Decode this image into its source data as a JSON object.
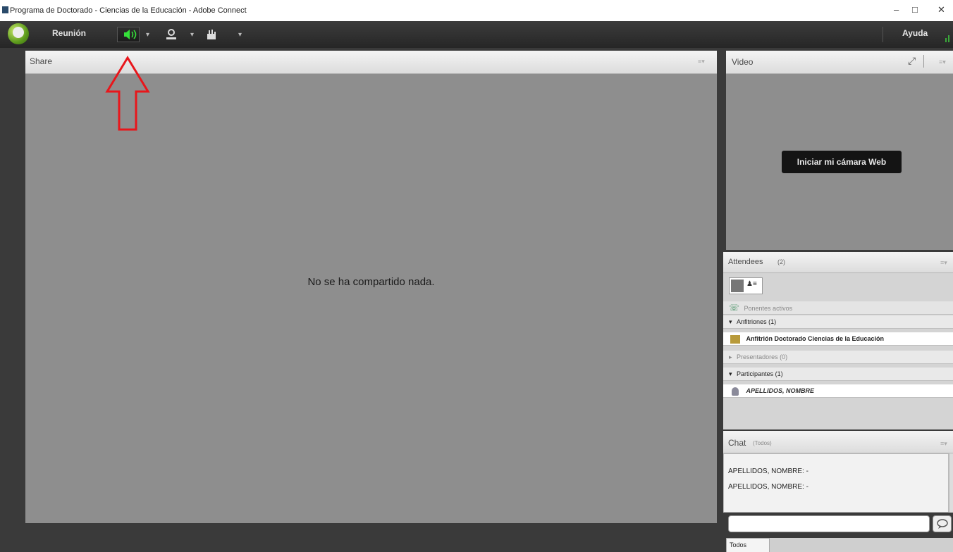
{
  "window": {
    "title": "Programa de Doctorado - Ciencias de la Educación - Adobe Connect",
    "minimize_glyph": "–",
    "maximize_glyph": "□",
    "close_glyph": "✕"
  },
  "menu": {
    "meeting_label": "Reunión",
    "help_label": "Ayuda",
    "dropdown_glyph": "▾",
    "audio_icon": "speaker-icon",
    "camera_icon": "webcam-icon",
    "status_icon": "raise-hand-icon"
  },
  "share_pod": {
    "title": "Share",
    "empty_message": "No se ha compartido nada.",
    "menu_glyph": "≡▾"
  },
  "video_pod": {
    "title": "Video",
    "start_camera_label": "Iniciar mi cámara Web",
    "fullscreen_glyph": "⤢",
    "menu_glyph": "≡▾"
  },
  "attendees_pod": {
    "title": "Attendees",
    "count": "(2)",
    "menu_glyph": "≡▾",
    "active_speakers_label": "Ponentes activos",
    "groups": [
      {
        "label": "Anfitriones (1)",
        "expanded_glyph": "▾"
      },
      {
        "label": "Presentadores (0)",
        "expanded_glyph": "▸"
      },
      {
        "label": "Participantes (1)",
        "expanded_glyph": "▾"
      }
    ],
    "host_name": "Anfitrión Doctorado Ciencias de la Educación",
    "participant_name": "APELLIDOS, NOMBRE"
  },
  "chat_pod": {
    "title": "Chat",
    "scope": "(Todos)",
    "menu_glyph": "≡▾",
    "messages": [
      "APELLIDOS, NOMBRE: -",
      "APELLIDOS, NOMBRE: -"
    ],
    "input_value": "",
    "tab_label": "Todos"
  },
  "colors": {
    "pod_background": "#8e8e8e",
    "app_background": "#3a3a3a",
    "audio_green": "#35e03a",
    "annotation_red": "#e8161b"
  }
}
